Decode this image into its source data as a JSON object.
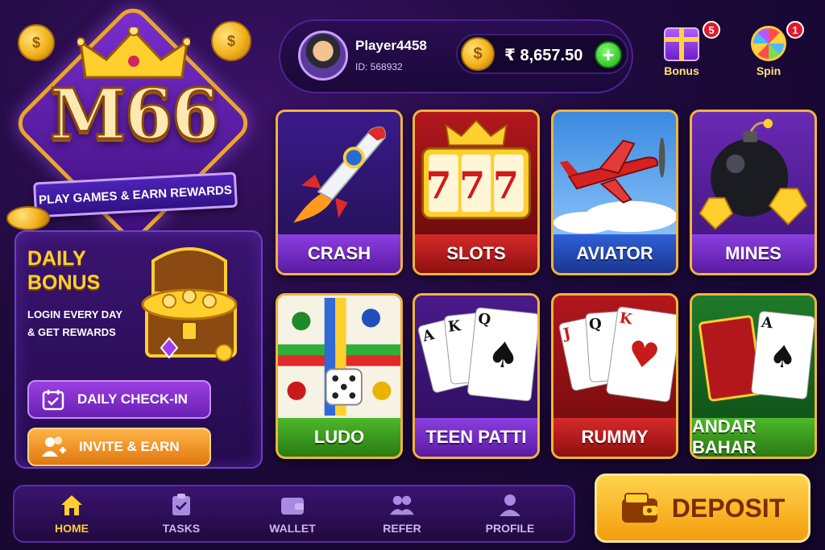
{
  "logo": {
    "text": "M66",
    "tagline": "PLAY GAMES & EARN REWARDS"
  },
  "daily_bonus": {
    "title_line1": "DAILY",
    "title_line2": "BONUS",
    "sub_line1": "LOGIN EVERY DAY",
    "sub_line2": "& GET REWARDS",
    "checkin_label": "DAILY CHECK-IN",
    "invite_label": "INVITE & EARN"
  },
  "player": {
    "name": "Player4458",
    "id": "ID: 568932"
  },
  "wallet": {
    "balance": "₹ 8,657.50",
    "coin_symbol": "$",
    "add_symbol": "+"
  },
  "top_actions": [
    {
      "label": "Bonus",
      "badge": "5",
      "icon": "gift-icon"
    },
    {
      "label": "Spin",
      "badge": "1",
      "icon": "wheel-icon"
    }
  ],
  "games": [
    {
      "name": "CRASH",
      "icon": "rocket-icon"
    },
    {
      "name": "SLOTS",
      "icon": "slot-machine-icon",
      "art_text": "777"
    },
    {
      "name": "AVIATOR",
      "icon": "airplane-icon"
    },
    {
      "name": "MINES",
      "icon": "bomb-icon"
    },
    {
      "name": "LUDO",
      "icon": "ludo-board-icon"
    },
    {
      "name": "TEEN PATTI",
      "icon": "cards-icon",
      "cards": [
        "A",
        "K",
        "Q"
      ]
    },
    {
      "name": "RUMMY",
      "icon": "cards-icon",
      "cards": [
        "J",
        "Q",
        "K"
      ]
    },
    {
      "name": "ANDAR BAHAR",
      "icon": "cards-icon",
      "cards": [
        "A"
      ]
    }
  ],
  "nav": [
    {
      "label": "HOME",
      "icon": "home-icon"
    },
    {
      "label": "TASKS",
      "icon": "tasks-icon"
    },
    {
      "label": "WALLET",
      "icon": "wallet-icon"
    },
    {
      "label": "REFER",
      "icon": "refer-icon"
    },
    {
      "label": "PROFILE",
      "icon": "profile-icon"
    }
  ],
  "deposit": {
    "label": "DEPOSIT"
  },
  "colors": {
    "accent_gold": "#ffcf2e",
    "purple": "#5a1aa3",
    "background": "#1e0a3c"
  }
}
